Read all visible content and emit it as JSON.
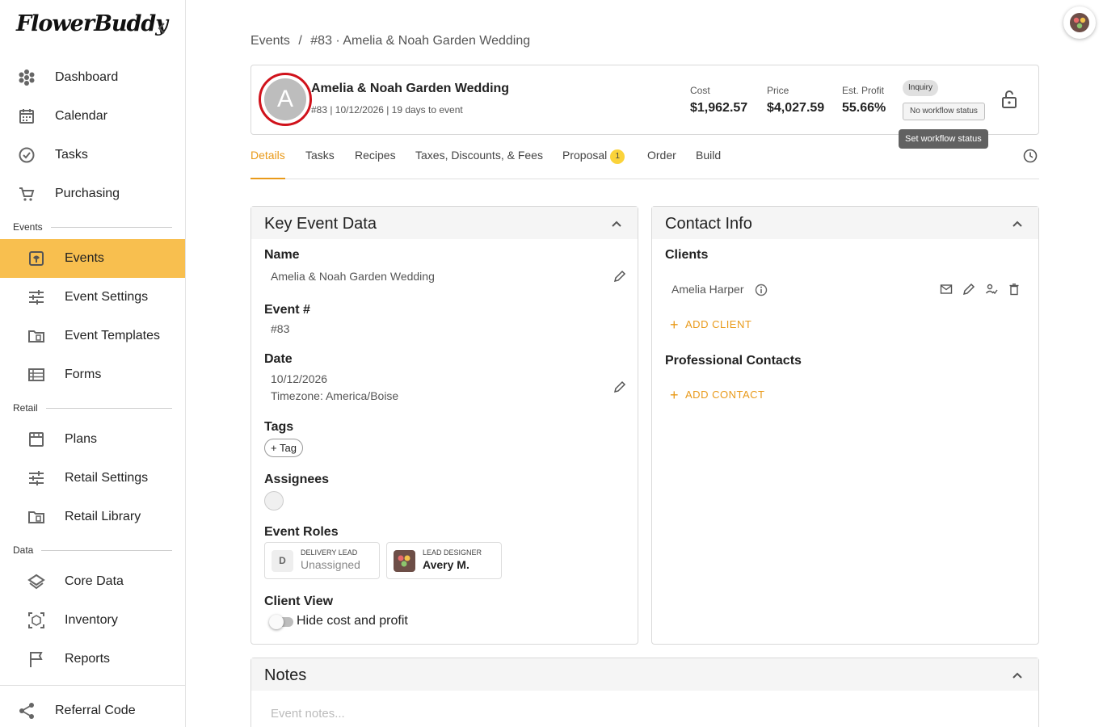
{
  "app": {
    "logo": "FlowerBuddy"
  },
  "sidebar": {
    "items": [
      {
        "label": "Dashboard"
      },
      {
        "label": "Calendar"
      },
      {
        "label": "Tasks"
      },
      {
        "label": "Purchasing"
      }
    ],
    "sections": {
      "events": {
        "title": "Events",
        "items": [
          {
            "label": "Events"
          },
          {
            "label": "Event Settings"
          },
          {
            "label": "Event Templates"
          },
          {
            "label": "Forms"
          }
        ]
      },
      "retail": {
        "title": "Retail",
        "items": [
          {
            "label": "Plans"
          },
          {
            "label": "Retail Settings"
          },
          {
            "label": "Retail Library"
          }
        ]
      },
      "data": {
        "title": "Data",
        "items": [
          {
            "label": "Core Data"
          },
          {
            "label": "Inventory"
          },
          {
            "label": "Reports"
          }
        ]
      }
    },
    "footer": {
      "label": "Referral Code"
    },
    "accent": "#f8bf4f"
  },
  "breadcrumb": {
    "root": "Events",
    "separator": "/",
    "current": "#83 · Amelia & Noah Garden Wedding"
  },
  "event": {
    "initial": "A",
    "title": "Amelia & Noah Garden Wedding",
    "subtitle": "#83 | 10/12/2026 | 19 days to event",
    "cost_label": "Cost",
    "cost": "$1,962.57",
    "price_label": "Price",
    "price": "$4,027.59",
    "profit_label": "Est. Profit",
    "profit": "55.66%",
    "status_chip": "Inquiry",
    "workflow_chip": "No workflow status",
    "tooltip": "Set workflow status"
  },
  "tabs": [
    {
      "label": "Details"
    },
    {
      "label": "Tasks"
    },
    {
      "label": "Recipes"
    },
    {
      "label": "Taxes, Discounts, & Fees"
    },
    {
      "label": "Proposal",
      "badge": "1"
    },
    {
      "label": "Order"
    },
    {
      "label": "Build"
    }
  ],
  "key_event": {
    "title": "Key Event Data",
    "name_label": "Name",
    "name_value": "Amelia & Noah Garden Wedding",
    "number_label": "Event #",
    "number_value": "#83",
    "date_label": "Date",
    "date_value": "10/12/2026",
    "timezone": "Timezone: America/Boise",
    "tags_label": "Tags",
    "tag_button": "+ Tag",
    "assignees_label": "Assignees",
    "roles_label": "Event Roles",
    "roles": [
      {
        "key": "DELIVERY LEAD",
        "initial": "D",
        "value": "Unassigned"
      },
      {
        "key": "LEAD DESIGNER",
        "value": "Avery M."
      }
    ],
    "client_view_label": "Client View",
    "toggle_label": "Hide cost and profit"
  },
  "contact": {
    "title": "Contact Info",
    "clients_label": "Clients",
    "clients": [
      {
        "name": "Amelia Harper"
      }
    ],
    "add_client": "ADD CLIENT",
    "pro_label": "Professional Contacts",
    "add_contact": "ADD CONTACT"
  },
  "notes": {
    "title": "Notes",
    "placeholder": "Event notes..."
  }
}
